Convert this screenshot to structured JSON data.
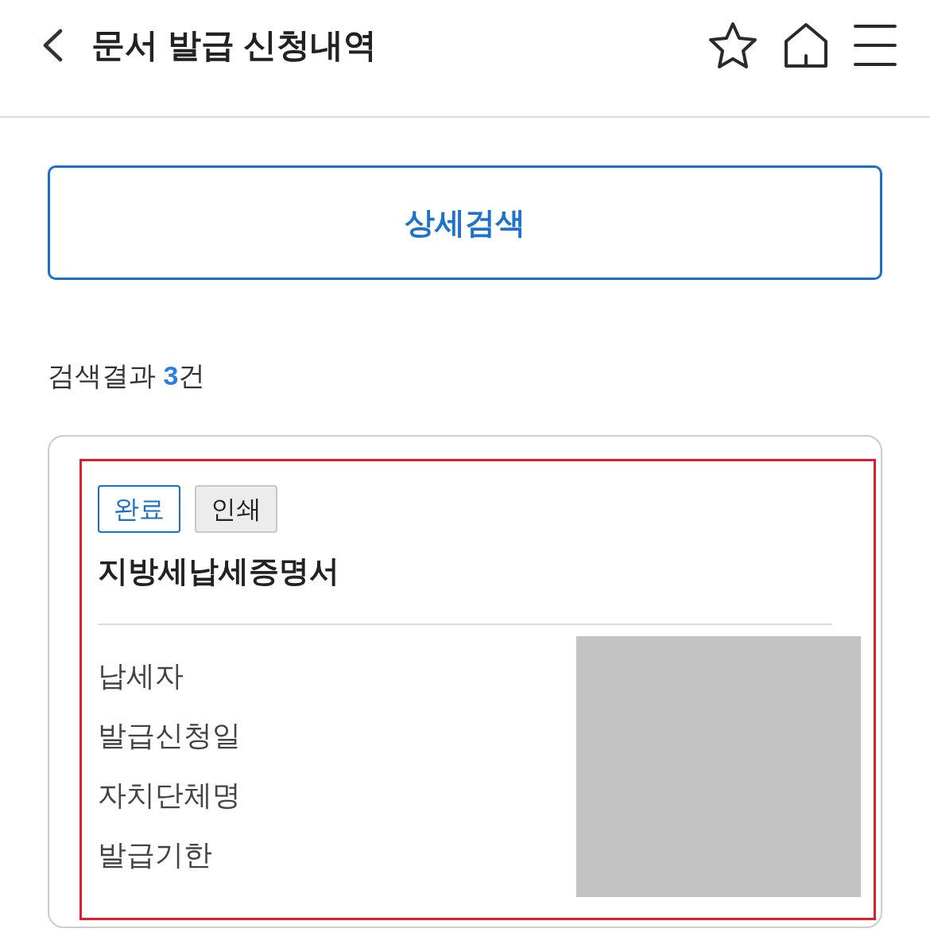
{
  "header": {
    "title": "문서 발급 신청내역"
  },
  "detail_search_button": {
    "label": "상세검색"
  },
  "results": {
    "summary": "검색결과 **3**건"
  },
  "cards": [
    {
      "highlighted": true,
      "badges": [
        {
          "label": "완료",
          "kind": "status"
        },
        {
          "label": "인쇄",
          "kind": "action"
        }
      ],
      "title": "지방세납세증명서",
      "fields": [
        "납세자",
        "발급신청일",
        "자치단체명",
        "발급기한"
      ]
    }
  ]
}
